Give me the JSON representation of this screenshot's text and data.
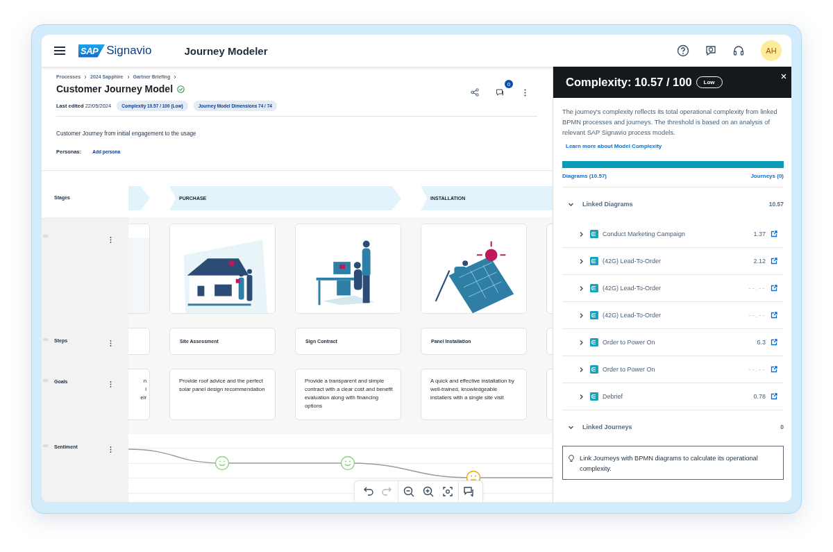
{
  "header": {
    "brand_mark": "SAP",
    "brand_name": "Signavio",
    "app_title": "Journey Modeler",
    "actions": [
      {
        "kind": "help"
      },
      {
        "kind": "feedback"
      },
      {
        "kind": "support"
      }
    ],
    "avatar": "AH"
  },
  "model": {
    "breadcrumb": [
      "Processes",
      "2024 Sapphire",
      "Gartner Briefing"
    ],
    "title": "Customer Journey Model",
    "valid": true,
    "last_edited_label": "Last edited",
    "last_edited": "22/05/2024",
    "tags": [
      "Complexity 10.57 / 100 (Low)",
      "Journey Model Dimensions 74 / 74"
    ],
    "comment_count": "0",
    "description": "Customer Journey from initial engagement to the usage",
    "personas_label": "Personas:",
    "add_persona": "Add persona"
  },
  "canvas": {
    "row_labels": {
      "stages": "Stages",
      "steps": "Steps",
      "goals": "Goals",
      "sentiment": "Sentiment"
    },
    "stages": [
      {
        "label": "PURCHASE"
      },
      {
        "label": "INSTALLATION"
      }
    ],
    "columns": [
      {
        "goal": "n\nl\neir"
      },
      {
        "step": "Site Assessment",
        "goal": "Provide roof advice and the perfect solar panel design recommendation"
      },
      {
        "step": "Sign Contract",
        "goal": "Provide a transparent and simple contract with a clear cost and benefit evaluation along with financing options"
      },
      {
        "step": "Panel Installation",
        "goal": "A quick and effective installation  by well-trained, knowledgeable installers with a single site visit"
      },
      {}
    ],
    "sentiment_points": [
      {
        "kind": "positive"
      },
      {
        "kind": "positive"
      },
      {
        "kind": "neutral"
      }
    ],
    "toolbar": [
      [
        {
          "kind": "undo",
          "disabled": false
        },
        {
          "kind": "redo",
          "disabled": true
        }
      ],
      [
        {
          "kind": "zoom_out",
          "disabled": false
        },
        {
          "kind": "zoom_in",
          "disabled": false
        },
        {
          "kind": "fit",
          "disabled": false
        }
      ],
      [
        {
          "kind": "comments",
          "disabled": false
        }
      ]
    ]
  },
  "panel": {
    "title": "Complexity: 10.57 / 100",
    "rating": "Low",
    "intro": "The journey's complexity reflects its total operational complexity from linked BPMN processes and journeys. The threshold is based on an analysis of relevant SAP Signavio process models.",
    "link": "Learn more about Model Complexity",
    "bar": {
      "level": 1,
      "left_label": "Diagrams (10.57)",
      "right_label": "Journeys (0)"
    },
    "sections": [
      {
        "title": "Linked Diagrams",
        "total": "10.57",
        "expanded": true,
        "items": [
          {
            "name": "Conduct Marketing Campaign",
            "value": "1.37",
            "expanded": false
          },
          {
            "name": "(42G) Lead-To-Order",
            "value": "2.12",
            "expanded": false
          },
          {
            "name": "(42G) Lead-To-Order",
            "value": "--.--",
            "expanded": false
          },
          {
            "name": "(42G) Lead-To-Order",
            "value": "--.--",
            "expanded": false
          },
          {
            "name": "Order to Power On",
            "value": "6.3",
            "expanded": false
          },
          {
            "name": "Order to Power On",
            "value": "--.--",
            "expanded": false
          },
          {
            "name": "Debrief",
            "value": "0.78",
            "expanded": false
          }
        ]
      },
      {
        "title": "Linked Journeys",
        "total": "0",
        "expanded": true,
        "hint": "Link Journeys with BPMN diagrams to calculate its operational complexity."
      }
    ]
  }
}
